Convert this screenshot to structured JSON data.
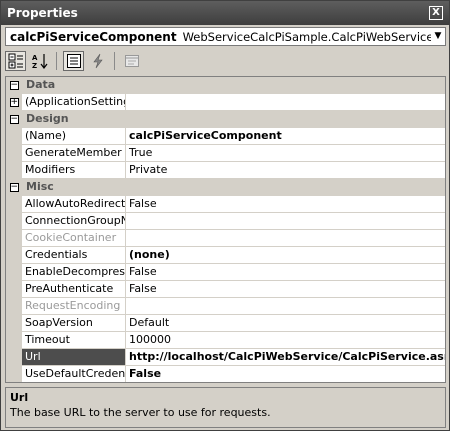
{
  "window": {
    "title": "Properties",
    "close_glyph": "X"
  },
  "object_selector": {
    "name": "calcPiServiceComponent",
    "type": "WebServiceCalcPiSample.CalcPiWebService.CalcPiService"
  },
  "toolbar": {
    "buttons": [
      "categorized-icon",
      "alphabetical-icon",
      "properties-icon",
      "events-icon",
      "property-pages-icon"
    ]
  },
  "grid": {
    "categories": [
      {
        "label": "Data"
      },
      {
        "label": "Design"
      },
      {
        "label": "Misc"
      }
    ],
    "data_rows": [
      {
        "name": "(ApplicationSettings)",
        "value": ""
      }
    ],
    "design_rows": [
      {
        "name": "(Name)",
        "value": "calcPiServiceComponent"
      },
      {
        "name": "GenerateMember",
        "value": "True"
      },
      {
        "name": "Modifiers",
        "value": "Private"
      }
    ],
    "misc_rows": [
      {
        "name": "AllowAutoRedirect",
        "value": "False"
      },
      {
        "name": "ConnectionGroupNam",
        "value": ""
      },
      {
        "name": "CookieContainer",
        "value": ""
      },
      {
        "name": "Credentials",
        "value": "(none)"
      },
      {
        "name": "EnableDecompression",
        "value": "False"
      },
      {
        "name": "PreAuthenticate",
        "value": "False"
      },
      {
        "name": "RequestEncoding",
        "value": ""
      },
      {
        "name": "SoapVersion",
        "value": "Default"
      },
      {
        "name": "Timeout",
        "value": "100000"
      },
      {
        "name": "Url",
        "value": "http://localhost/CalcPiWebService/CalcPiService.asmx"
      },
      {
        "name": "UseDefaultCredential",
        "value": "False"
      }
    ]
  },
  "description": {
    "title": "Url",
    "text": "The base URL to the server to use for requests."
  }
}
